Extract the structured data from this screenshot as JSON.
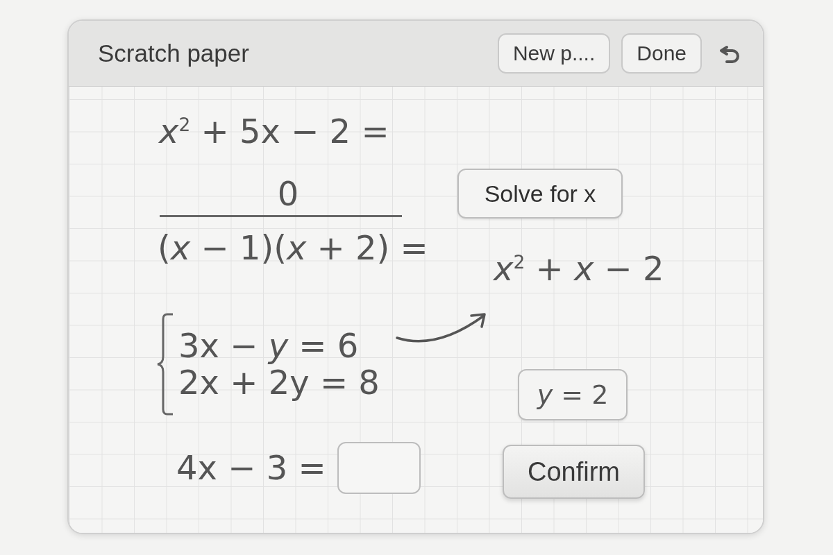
{
  "window": {
    "title": "Scratch paper"
  },
  "header_buttons": [
    {
      "label": "New p...."
    },
    {
      "label": "Done"
    }
  ],
  "canvas": {
    "items": [
      {
        "kind": "expression",
        "text": "*x*$^{2}$ + 5x − 2 ="
      },
      {
        "kind": "expression",
        "text": "0"
      },
      {
        "kind": "rule"
      },
      {
        "kind": "expression",
        "text": "(*x* − 1)(*x* + 2) ="
      },
      {
        "kind": "button",
        "text": "Solve for x"
      },
      {
        "kind": "expression",
        "text": "*x*$^{2}$ + *x* − 2"
      },
      {
        "kind": "system",
        "lines": [
          "3x − *y* = 6",
          "2x + 2y = 8"
        ]
      },
      {
        "kind": "arrow"
      },
      {
        "kind": "chip",
        "text": "*y* = 2"
      },
      {
        "kind": "blank",
        "text": "4x − 3 ="
      },
      {
        "kind": "raised_button",
        "text": "Confirm"
      }
    ]
  }
}
